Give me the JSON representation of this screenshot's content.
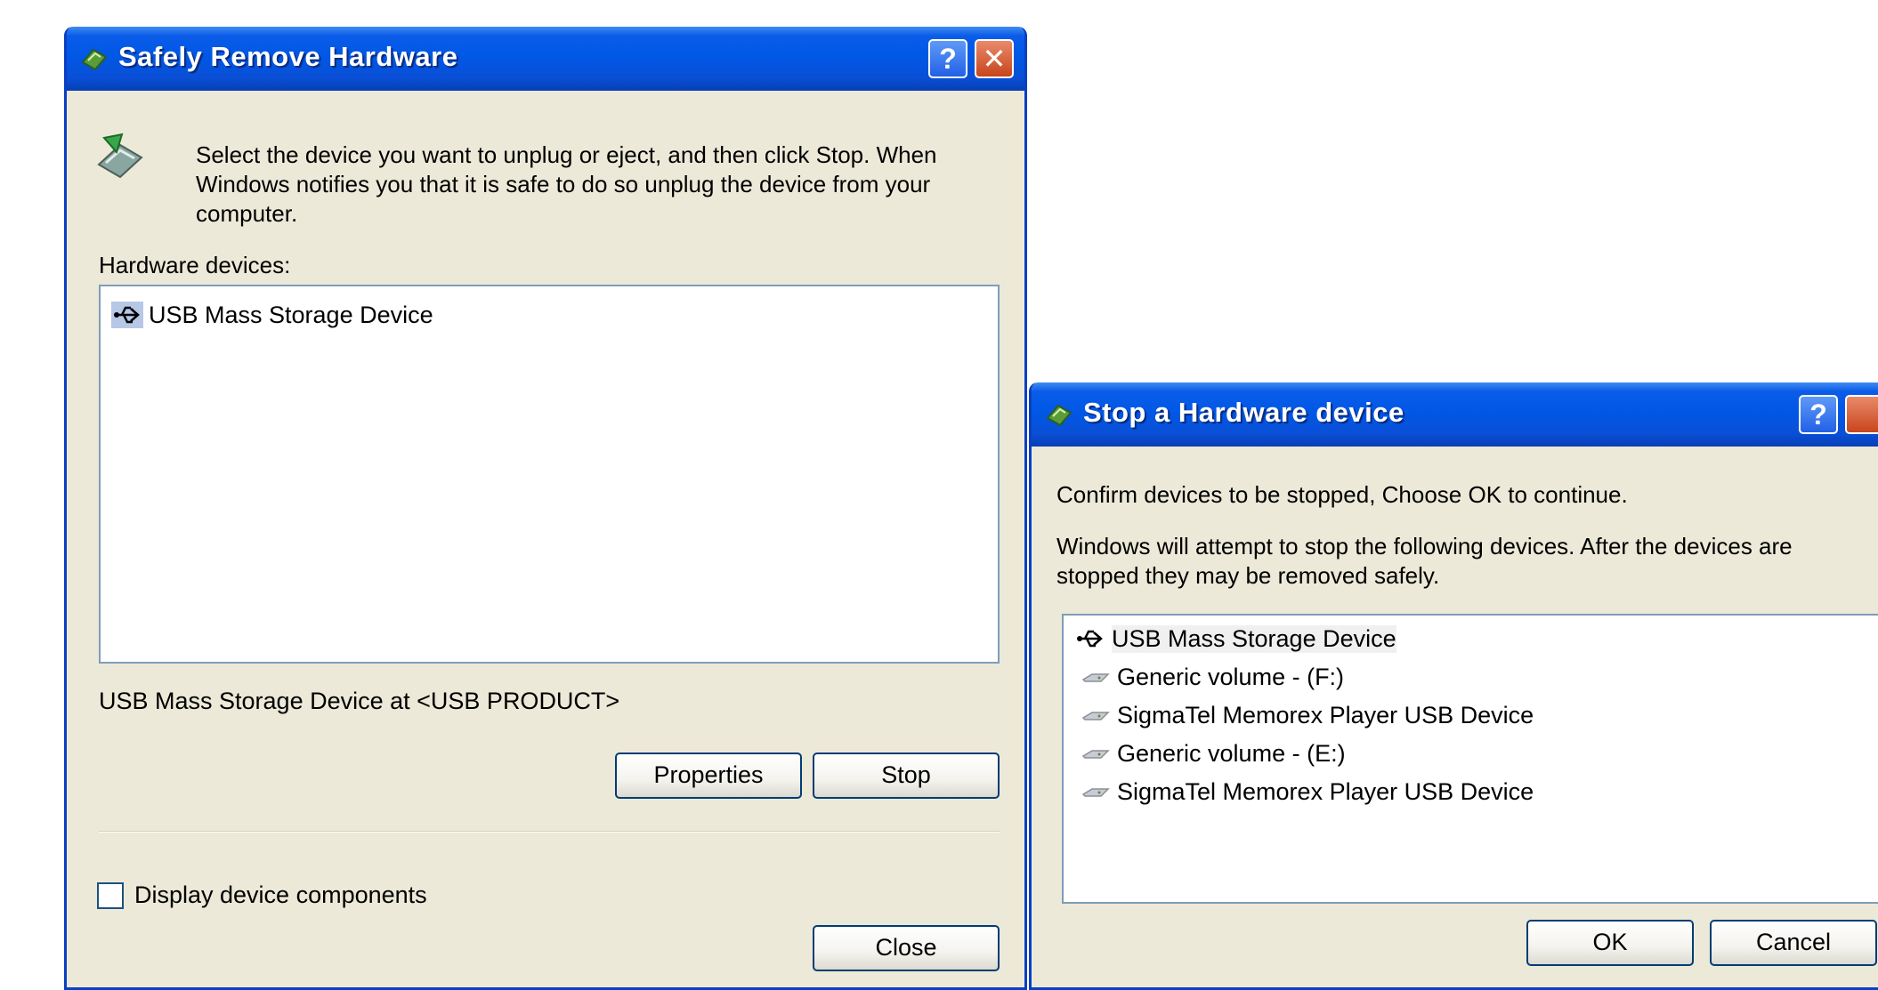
{
  "left_dialog": {
    "title": "Safely Remove Hardware",
    "help_glyph": "?",
    "close_glyph": "✕",
    "instructions": [
      "Select the device you want to unplug or eject, and then click Stop. When",
      "Windows notifies you that it is safe to do so unplug the device from your",
      "computer."
    ],
    "list_label": "Hardware devices:",
    "devices": [
      {
        "label": "USB Mass Storage Device",
        "icon": "usb-icon"
      }
    ],
    "selected_description": "USB Mass Storage Device at <USB PRODUCT>",
    "properties_label": "Properties",
    "stop_label": "Stop",
    "checkbox_label": "Display device components",
    "checkbox_checked": false,
    "close_label": "Close"
  },
  "right_dialog": {
    "title": "Stop a Hardware device",
    "help_glyph": "?",
    "confirm_text": "Confirm devices to be stopped, Choose OK to continue.",
    "info_text": [
      "Windows will attempt to stop the following devices. After the devices are",
      "stopped they may be removed safely."
    ],
    "devices": [
      {
        "label": "USB Mass Storage Device",
        "icon": "usb-icon"
      },
      {
        "label": "Generic volume - (F:)",
        "icon": "drive-icon"
      },
      {
        "label": "SigmaTel Memorex Player USB Device",
        "icon": "drive-icon"
      },
      {
        "label": "Generic volume - (E:)",
        "icon": "drive-icon"
      },
      {
        "label": "SigmaTel Memorex Player USB Device",
        "icon": "drive-icon"
      }
    ],
    "ok_label": "OK",
    "cancel_label": "Cancel"
  },
  "colors": {
    "titlebar_blue": "#0058e6",
    "dialog_face": "#ece9d8",
    "button_border": "#003c74",
    "list_border": "#7f9db9"
  }
}
